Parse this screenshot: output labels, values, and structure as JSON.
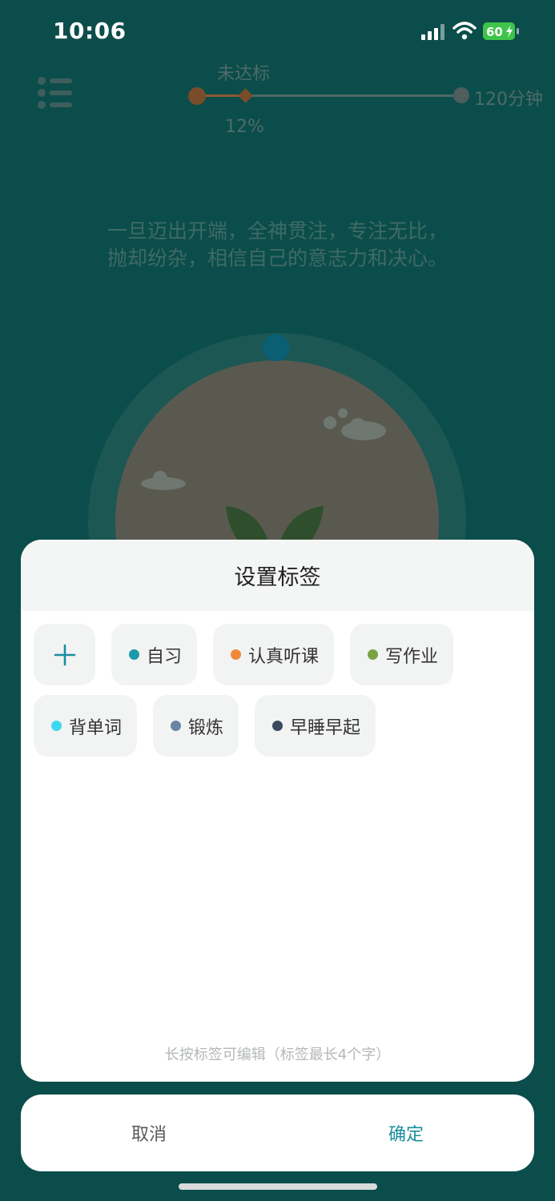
{
  "status_bar": {
    "time": "10:06",
    "battery_level": "60"
  },
  "progress": {
    "status": "未达标",
    "percent_label": "12%",
    "target_label": "120分钟"
  },
  "quote": {
    "line1": "一旦迈出开端，全神贯注，专注无比，",
    "line2": "抛却纷杂，相信自己的意志力和决心。"
  },
  "modal": {
    "title": "设置标签",
    "add_icon": "plus-icon",
    "tags": [
      {
        "label": "自习",
        "color": "#1a9aaa"
      },
      {
        "label": "认真听课",
        "color": "#f08a3a"
      },
      {
        "label": "写作业",
        "color": "#7ba246"
      },
      {
        "label": "背单词",
        "color": "#3ed8f0"
      },
      {
        "label": "锻炼",
        "color": "#6a84a3"
      },
      {
        "label": "早睡早起",
        "color": "#3a4a60"
      }
    ],
    "hint": "长按标签可编辑（标签最长4个字）"
  },
  "actions": {
    "cancel": "取消",
    "confirm": "确定"
  },
  "colors": {
    "background": "#0b4d4a",
    "accent": "#1a8ea0"
  }
}
